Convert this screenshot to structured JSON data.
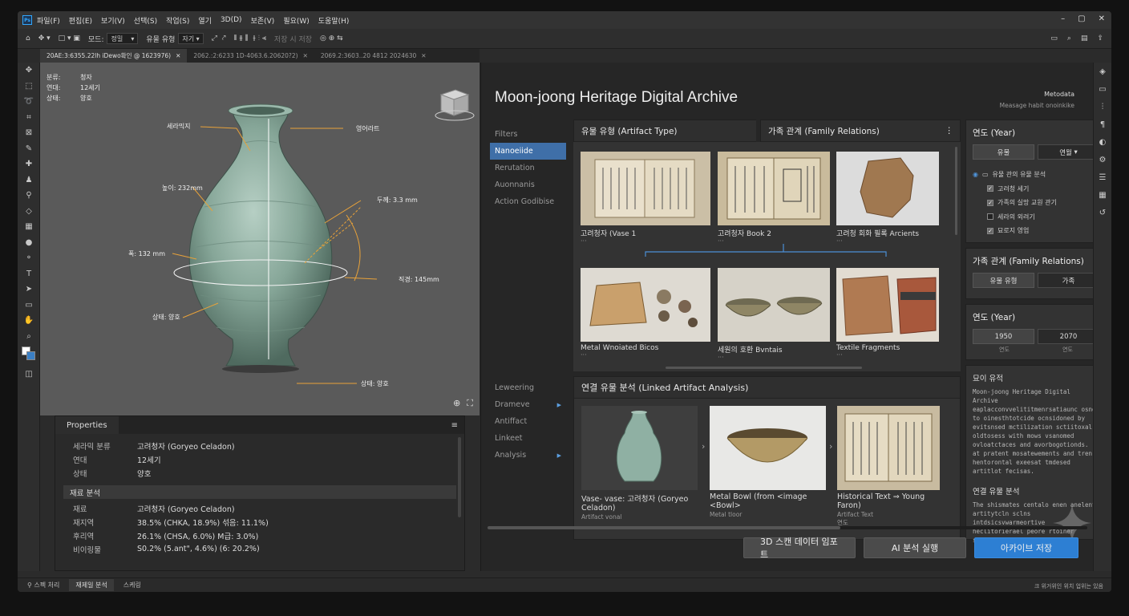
{
  "menubar": {
    "items": [
      "파일(F)",
      "편집(E)",
      "보기(V)",
      "선택(S)",
      "작업(S)",
      "열기",
      "3D(D)",
      "보존(V)",
      "필요(W)",
      "도움말(H)"
    ]
  },
  "options": {
    "mode_label": "모드:",
    "mode_value": "정밀",
    "type_label": "유물 유형",
    "type_value": "자기",
    "save_label": "저장 시 저장"
  },
  "tabs": [
    {
      "label": "20AE:3:6355.22lh iDewo확인 @ 1623976)"
    },
    {
      "label": "2062.:2:6233 1D-4063.6.20620?2)"
    },
    {
      "label": "2069.2:3603..20 4812 2024630"
    }
  ],
  "canvas": {
    "meta": [
      {
        "k": "분류:",
        "v": "청자"
      },
      {
        "k": "연대:",
        "v": "12세기"
      },
      {
        "k": "상태:",
        "v": "양호"
      }
    ],
    "annotations": {
      "neck": "세라믹지",
      "rim": "영어라트",
      "height": "높이: 232mm",
      "thickness": "두께: 3.3 mm",
      "width": "폭: 132 mm",
      "diameter": "직경: 145mm",
      "cond1": "상태: 양호",
      "cond2": "상태: 양호"
    }
  },
  "properties": {
    "tab": "Properties",
    "rows": [
      {
        "k": "세라믹 분류",
        "v": "고려청자 (Goryeo Celadon)"
      },
      {
        "k": "연대",
        "v": "12세기"
      },
      {
        "k": "상태",
        "v": "양호"
      }
    ],
    "section": "재료 분석",
    "rows2": [
      {
        "k": "재료",
        "v": "고려청자 (Goryeo Celadon)"
      },
      {
        "k": "재지역",
        "v": "38.5% (CHKA, 18.9%) 섞음: 11.1%)"
      },
      {
        "k": "후리역",
        "v": "26.1% (CHSA, 6.0%) M급: 3.0%)"
      },
      {
        "k": "비이링물",
        "v": "S0.2% (5.ant\", 4.6%) (6: 20.2%)"
      }
    ]
  },
  "statusbar": {
    "items": [
      "스펙 처리",
      "재제일 분석",
      "스케링"
    ],
    "right": "크 위거위인 위치 업위는 있음"
  },
  "archive": {
    "title": "Moon-joong Heritage Digital Archive",
    "meta_label": "Metodata",
    "meta_sub": "Measage habit onoinkike",
    "filters": {
      "head": "Filters",
      "items": [
        "Nanoeiide",
        "Rerutation",
        "Auonnanis",
        "Action Godibise"
      ]
    },
    "filters2": {
      "items": [
        "Leweering",
        "Drameve",
        "Antiffact",
        "Linkeet",
        "Analysis"
      ]
    },
    "artifact_panel": {
      "title": "유물 유형 (Artifact Type)"
    },
    "family_panel": {
      "title": "가족 관계 (Family Relations)"
    },
    "thumbs": [
      {
        "label": "고려청자 (Vase 1"
      },
      {
        "label": "고려청자 Book 2"
      },
      {
        "label": "고려청 회화 필록 Arcients"
      },
      {
        "label": "Metal Wnoiated Bicos"
      },
      {
        "label": "세원의 호환 Bvntais"
      },
      {
        "label": "Textile Fragments"
      }
    ],
    "year_panel": {
      "title": "연도 (Year)",
      "btn1": "유물",
      "btn2": "연월"
    },
    "tree": {
      "root": "유물 관의 유물 분석",
      "items": [
        {
          "label": "고려청 세기",
          "checked": true
        },
        {
          "label": "가족의 실망 교원 관기",
          "checked": true
        },
        {
          "label": "세라의 외려기",
          "checked": false
        },
        {
          "label": "묘로지 영업",
          "checked": true
        }
      ]
    },
    "family2": {
      "title": "가족 관계 (Family Relations)",
      "btn1": "유물 유형",
      "btn2": "가족"
    },
    "year2": {
      "title": "연도 (Year)",
      "from": "1950",
      "to": "2070",
      "from_lab": "연도",
      "to_lab": "연도"
    },
    "linked": {
      "title": "연결 유물 분석 (Linked Artifact Analysis)",
      "items": [
        {
          "t1": "Vase- vase: 고려청자 (Goryeo",
          "t2": "Celadon)",
          "t3": "Artifact vonal"
        },
        {
          "t1": "Metal Bowl (from <image",
          "t2": "<Bowl>",
          "t3": "Metal tloor"
        },
        {
          "t1": "Historical Text ⇒ Young",
          "t2": "Faron)",
          "t3": "Artifact Text",
          "t4": "연도"
        }
      ]
    },
    "desc": {
      "title": "묘이 유적",
      "body": "Moon-joong Heritage Digital Archive eaplacconvvelititmenrsatiaunc osng to oinesthtotcide ocnsidoned by evitsnsed mctilization sctiitoxal oldtosess with mows vsanomed ovloatctaces and avorbogotionds. at pratent mosatewements and tren hentorontal exeesat tmdesed artitlot fecisas.",
      "title2": "연결 유물 분석",
      "body2": "The shismates centalo enen anelent artitytcln sclns intdsicsvwarmeortive heclitorierael peore rtoiner setiest heoovers."
    },
    "buttons": {
      "import": "3D 스캔 데이터 임포트",
      "ai": "AI 분석 실행",
      "save": "아카이브 저장"
    }
  },
  "colors": {
    "accent": "#2d7fd3",
    "celadon": "#8fb0a3",
    "annotation": "#e8a23a"
  }
}
